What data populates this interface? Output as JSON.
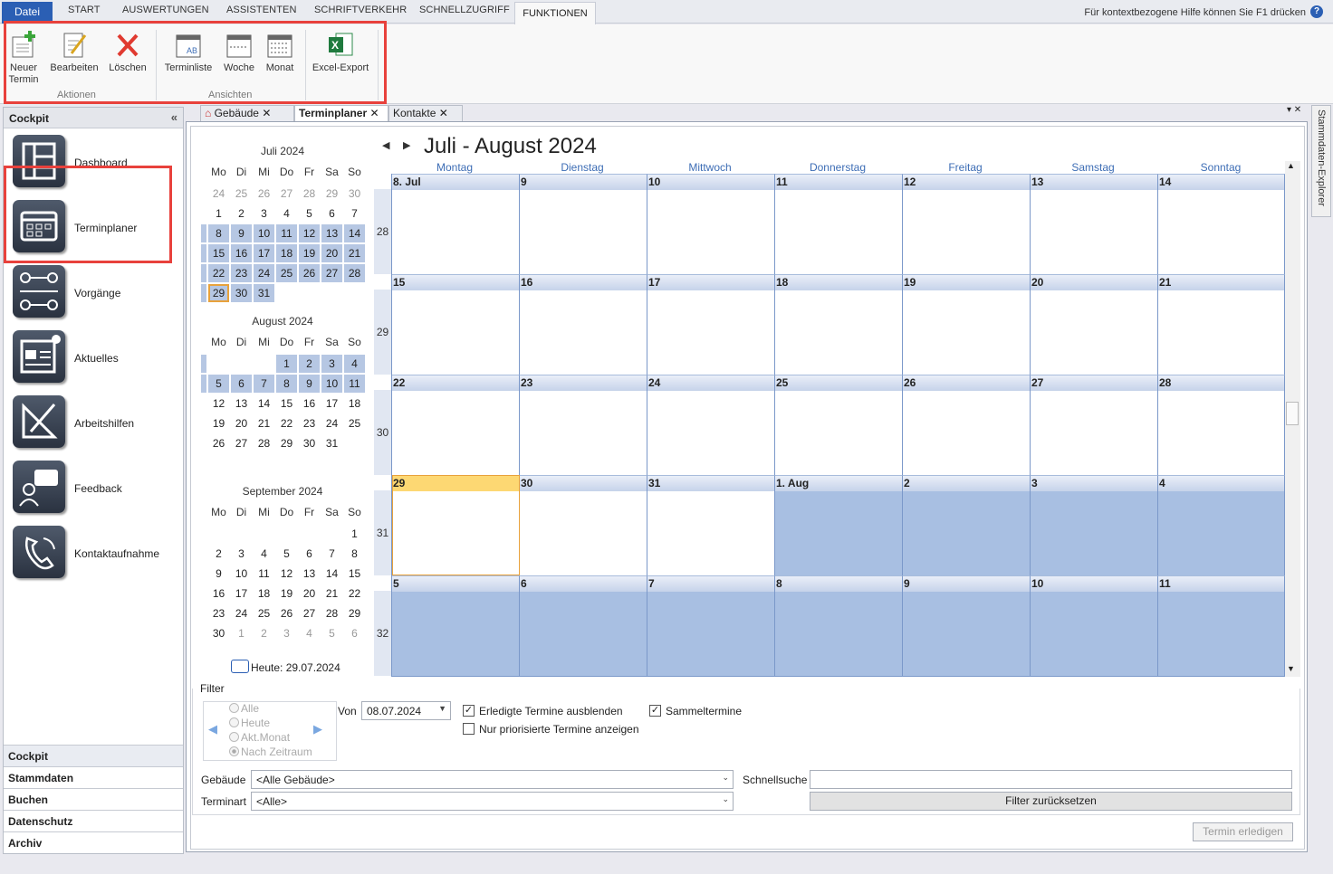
{
  "ribbon_tabs": {
    "datei": "Datei",
    "start": "START",
    "auswertungen": "AUSWERTUNGEN",
    "assistenten": "ASSISTENTEN",
    "schriftverkehr": "SCHRIFTVERKEHR",
    "schnellzugriff": "SCHNELLZUGRIFF",
    "funktionen": "FUNKTIONEN"
  },
  "help": {
    "text": "Für kontextbezogene Hilfe können Sie F1 drücken",
    "icon": "help-icon"
  },
  "ribbon": {
    "neuer_termin": "Neuer Termin",
    "bearbeiten": "Bearbeiten",
    "loeschen": "Löschen",
    "group_aktionen": "Aktionen",
    "terminliste": "Terminliste",
    "woche": "Woche",
    "monat": "Monat",
    "group_ansichten": "Ansichten",
    "excel_export": "Excel-Export"
  },
  "sidebar": {
    "title": "Cockpit",
    "items": [
      "Dashboard",
      "Terminplaner",
      "Vorgänge",
      "Aktuelles",
      "Arbeitshilfen",
      "Feedback",
      "Kontaktaufnahme"
    ],
    "bottom": [
      "Cockpit",
      "Stammdaten",
      "Buchen",
      "Datenschutz",
      "Archiv"
    ]
  },
  "doc_tabs": [
    "Gebäude",
    "Terminplaner",
    "Kontakte"
  ],
  "explorer": "Stammdaten-Explorer",
  "mini": {
    "weekdays": [
      "Mo",
      "Di",
      "Mi",
      "Do",
      "Fr",
      "Sa",
      "So"
    ],
    "months": [
      {
        "title": "Juli 2024",
        "rows": [
          [
            "24",
            "25",
            "26",
            "27",
            "28",
            "29",
            "30"
          ],
          [
            "1",
            "2",
            "3",
            "4",
            "5",
            "6",
            "7"
          ],
          [
            "8",
            "9",
            "10",
            "11",
            "12",
            "13",
            "14"
          ],
          [
            "15",
            "16",
            "17",
            "18",
            "19",
            "20",
            "21"
          ],
          [
            "22",
            "23",
            "24",
            "25",
            "26",
            "27",
            "28"
          ],
          [
            "29",
            "30",
            "31",
            "",
            "",
            "",
            ""
          ]
        ]
      },
      {
        "title": "August 2024",
        "rows": [
          [
            "",
            "",
            "",
            "1",
            "2",
            "3",
            "4"
          ],
          [
            "5",
            "6",
            "7",
            "8",
            "9",
            "10",
            "11"
          ],
          [
            "12",
            "13",
            "14",
            "15",
            "16",
            "17",
            "18"
          ],
          [
            "19",
            "20",
            "21",
            "22",
            "23",
            "24",
            "25"
          ],
          [
            "26",
            "27",
            "28",
            "29",
            "30",
            "31",
            ""
          ]
        ]
      },
      {
        "title": "September 2024",
        "rows": [
          [
            "",
            "",
            "",
            "",
            "",
            "",
            "1"
          ],
          [
            "2",
            "3",
            "4",
            "5",
            "6",
            "7",
            "8"
          ],
          [
            "9",
            "10",
            "11",
            "12",
            "13",
            "14",
            "15"
          ],
          [
            "16",
            "17",
            "18",
            "19",
            "20",
            "21",
            "22"
          ],
          [
            "23",
            "24",
            "25",
            "26",
            "27",
            "28",
            "29"
          ],
          [
            "30",
            "1",
            "2",
            "3",
            "4",
            "5",
            "6"
          ]
        ]
      }
    ],
    "today": "Heute: 29.07.2024"
  },
  "calendar": {
    "title": "Juli - August 2024",
    "days": [
      "Montag",
      "Dienstag",
      "Mittwoch",
      "Donnerstag",
      "Freitag",
      "Samstag",
      "Sonntag"
    ],
    "weeks": [
      {
        "nr": "28",
        "dates": [
          "8. Jul",
          "9",
          "10",
          "11",
          "12",
          "13",
          "14"
        ]
      },
      {
        "nr": "29",
        "dates": [
          "15",
          "16",
          "17",
          "18",
          "19",
          "20",
          "21"
        ]
      },
      {
        "nr": "30",
        "dates": [
          "22",
          "23",
          "24",
          "25",
          "26",
          "27",
          "28"
        ]
      },
      {
        "nr": "31",
        "dates": [
          "29",
          "30",
          "31",
          "1. Aug",
          "2",
          "3",
          "4"
        ]
      },
      {
        "nr": "32",
        "dates": [
          "5",
          "6",
          "7",
          "8",
          "9",
          "10",
          "11"
        ]
      }
    ]
  },
  "filter": {
    "label": "Filter",
    "radios": [
      "Alle",
      "Heute",
      "Akt.Monat",
      "Nach Zeitraum"
    ],
    "von_label": "Von",
    "von_value": "08.07.2024",
    "erledigte": "Erledigte Termine ausblenden",
    "sammel": "Sammeltermine",
    "priorisiert": "Nur priorisierte Termine anzeigen",
    "gebaeude_label": "Gebäude",
    "gebaeude_value": "<Alle Gebäude>",
    "terminart_label": "Terminart",
    "terminart_value": "<Alle>",
    "schnellsuche_label": "Schnellsuche",
    "schnellsuche_value": "",
    "reset": "Filter zurücksetzen",
    "erledigen": "Termin erledigen"
  }
}
